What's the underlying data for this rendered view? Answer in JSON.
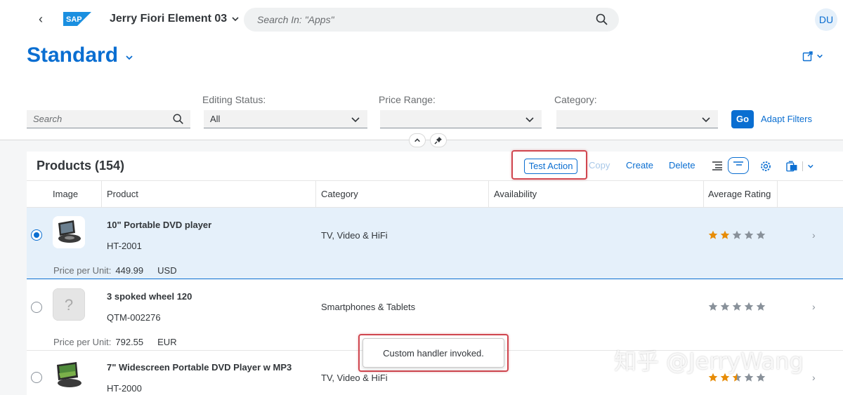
{
  "shell": {
    "app_title": "Jerry Fiori Element 03",
    "search_placeholder": "Search In: \"Apps\"",
    "avatar_initials": "DU"
  },
  "header": {
    "variant_title": "Standard",
    "filters": {
      "search_placeholder": "Search",
      "editing_status_label": "Editing Status:",
      "editing_status_value": "All",
      "price_range_label": "Price Range:",
      "price_range_value": "",
      "category_label": "Category:",
      "category_value": "",
      "go_label": "Go",
      "adapt_label": "Adapt Filters"
    }
  },
  "table": {
    "title": "Products (154)",
    "toolbar": {
      "test_action": "Test Action",
      "copy": "Copy",
      "create": "Create",
      "delete": "Delete"
    },
    "columns": [
      "Image",
      "Product",
      "Category",
      "Availability",
      "Average Rating"
    ],
    "price_label": "Price per Unit:",
    "rows": [
      {
        "name": "10\" Portable DVD player",
        "id": "HT-2001",
        "category": "TV, Video & HiFi",
        "price": "449.99",
        "currency": "USD",
        "rating": 2,
        "selected": true
      },
      {
        "name": "3 spoked wheel 120",
        "id": "QTM-002276",
        "category": "Smartphones & Tablets",
        "price": "792.55",
        "currency": "EUR",
        "rating": 0,
        "selected": false
      },
      {
        "name": "7\" Widescreen Portable DVD Player w MP3",
        "id": "HT-2000",
        "category": "TV, Video & HiFi",
        "price": "",
        "currency": "",
        "rating": 2.5,
        "selected": false
      }
    ]
  },
  "toast": {
    "message": "Custom handler invoked."
  },
  "watermark": "知乎 @JerryWang",
  "colors": {
    "accent": "#0a6ed1",
    "star": "#e78c07",
    "star_empty": "#89919a",
    "highlight": "#d0464f"
  }
}
